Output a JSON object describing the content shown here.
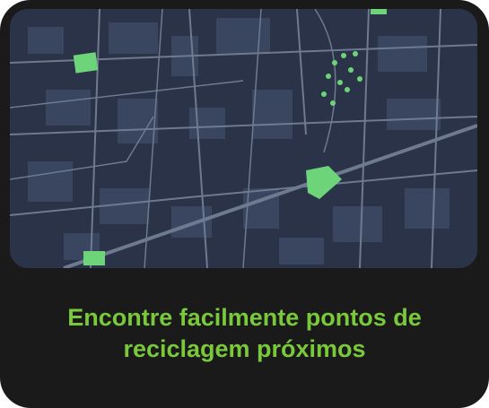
{
  "caption": {
    "line1": "Encontre facilmente pontos de",
    "line2": "reciclagem próximos"
  },
  "map": {
    "icon": "city-street-map",
    "colors": {
      "background": "#2a3347",
      "roads": "#6e7a8f",
      "blocks": "#3a4660",
      "parks": "#6ed47a",
      "caption": "#79c93a",
      "card": "#1a1a1a"
    }
  }
}
